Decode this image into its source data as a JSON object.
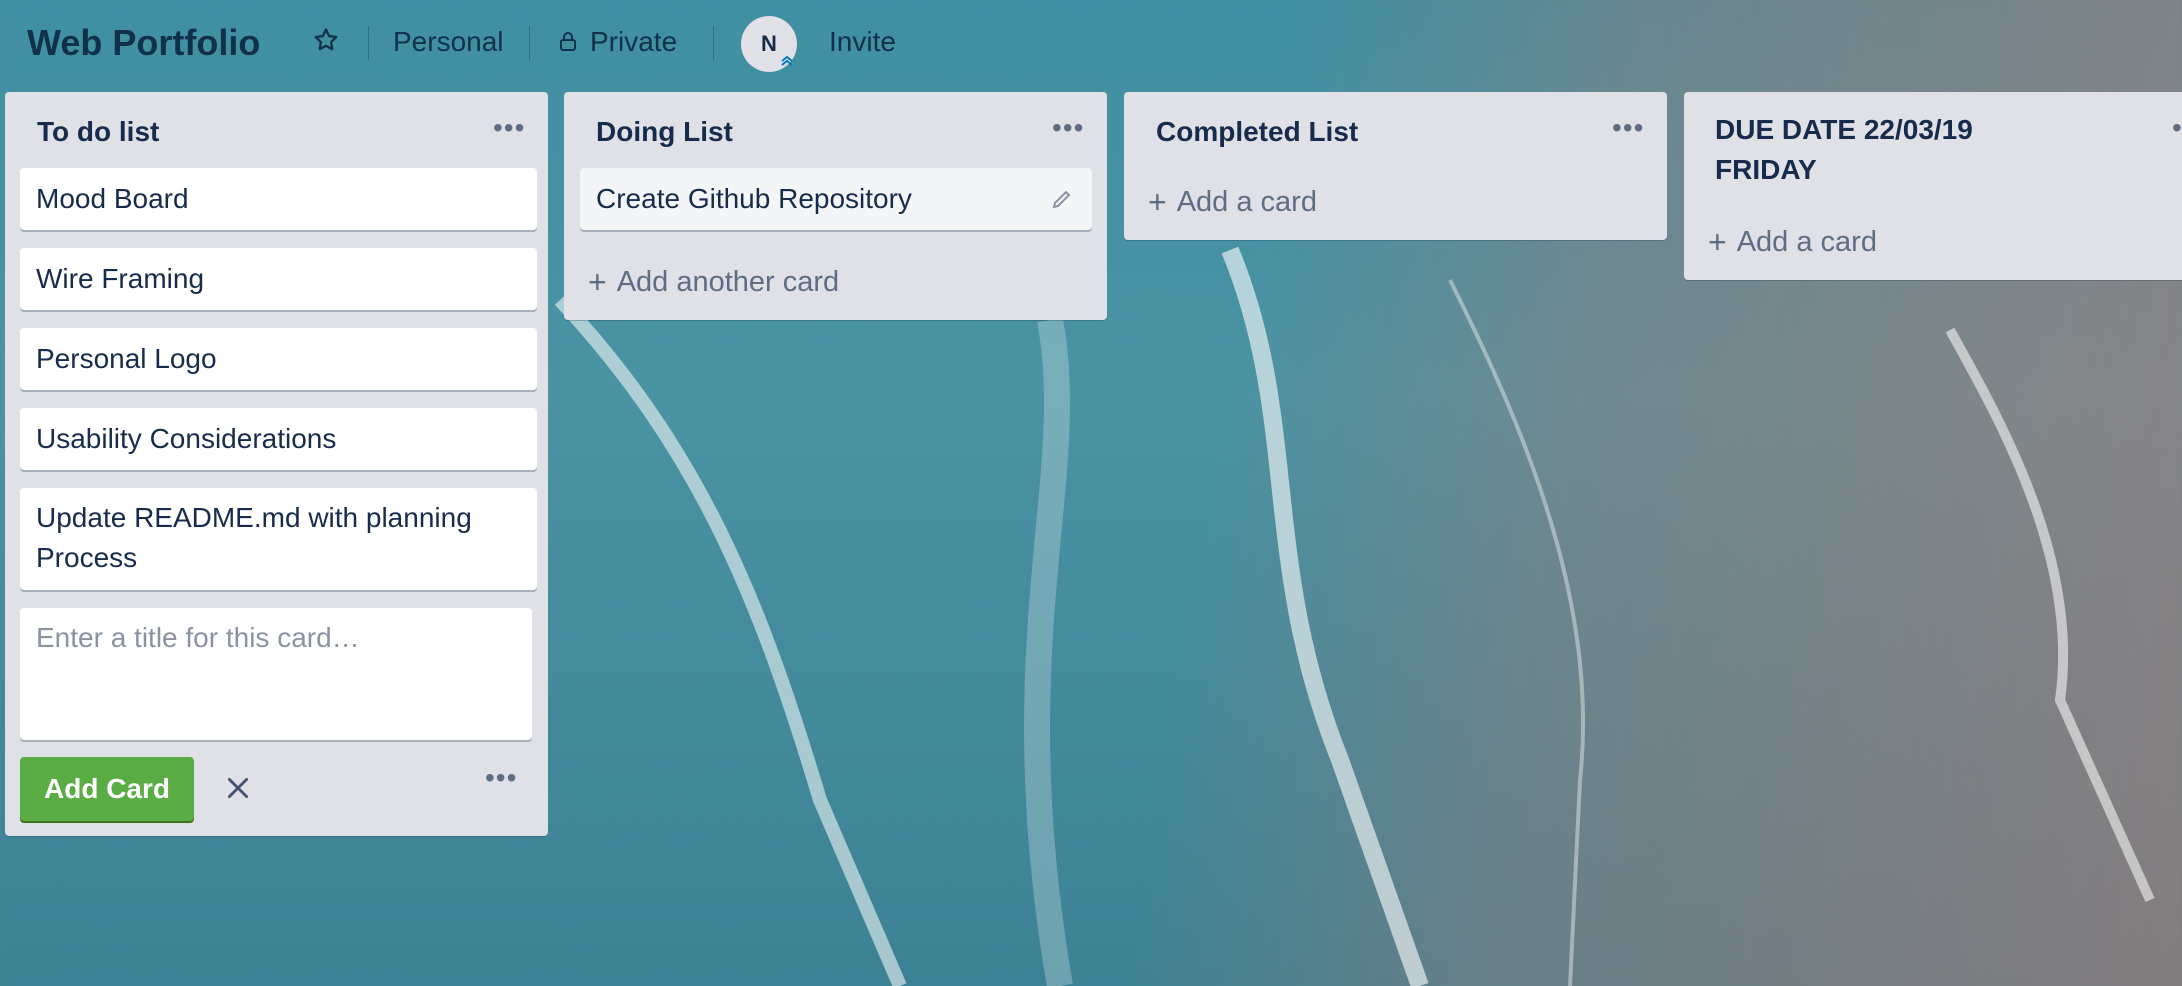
{
  "header": {
    "board_title": "Web Portfolio",
    "star_icon": "star-icon",
    "team_label": "Personal",
    "visibility_icon": "lock-icon",
    "visibility_label": "Private",
    "avatar_initial": "N",
    "invite_label": "Invite"
  },
  "lists": [
    {
      "title": "To do list",
      "cards": [
        "Mood Board",
        "Wire Framing",
        "Personal Logo",
        "Usability Considerations",
        "Update README.md with planning Process"
      ],
      "composer": {
        "placeholder": "Enter a title for this card…",
        "add_button": "Add Card"
      }
    },
    {
      "title": "Doing List",
      "cards": [
        "Create Github Repository"
      ],
      "add_label": "Add another card"
    },
    {
      "title": "Completed List",
      "cards": [],
      "add_label": "Add a card"
    },
    {
      "title": "DUE DATE 22/03/19 FRIDAY",
      "cards": [],
      "add_label": "Add a card"
    }
  ],
  "colors": {
    "accent_green": "#5aac44",
    "list_bg": "#dfe1e6",
    "text_primary": "#172b4d"
  }
}
